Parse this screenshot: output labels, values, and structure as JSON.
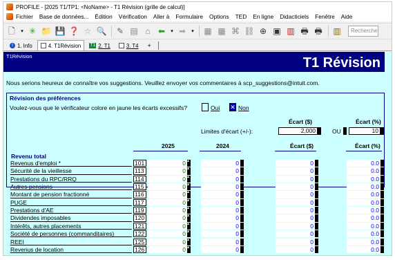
{
  "window": {
    "title": "PROFILE - [2025 T1/TP1: <NoName> - T1 Révision (grille de calcul)]"
  },
  "menu": [
    "Fichier",
    "Base de données...",
    "Édition",
    "Vérification",
    "Aller à",
    "Formulaire",
    "Options",
    "TED",
    "En ligne",
    "Didacticiels",
    "Fenêtre",
    "Aide"
  ],
  "toolbar": {
    "search_placeholder": "Recherche"
  },
  "tabs": [
    {
      "label": "1. Info",
      "icon": "info-icon"
    },
    {
      "label": "4. T1Révision",
      "icon": "document-icon",
      "active": true
    },
    {
      "label": "2. T1",
      "icon": "t1-form-icon"
    },
    {
      "label": "3. T4",
      "icon": "t4-form-icon"
    },
    {
      "label": "+"
    }
  ],
  "form": {
    "small_title": "T1Révision",
    "big_title": "T1 Révision",
    "suggestion": "Nous serions heureux de connaître vos suggestions.  Veuillez envoyer vos commentaires à scp_suggestions@intuit.com.",
    "pref_title": "Révision des préférences",
    "pref_question": "Voulez-vous que le vérificateur colore en jaune les écarts excessifs?",
    "oui": "Oui",
    "non": "Non",
    "ecart_dollar": "Écart ($)",
    "ecart_pct": "Écart (%)",
    "limites_label": "Limites d'écart (+/-):",
    "limit_dollar": "2,000",
    "limit_pct": "10",
    "ou": "OU",
    "col_2025": "2025",
    "col_2024": "2024",
    "section": "Revenu total",
    "rows": [
      {
        "label": "Revenus d'emploi *",
        "code": "101",
        "v2025": "0",
        "v2024": "0",
        "ecart": "0",
        "pct": "0.0"
      },
      {
        "label": "Sécurité de la vieillesse",
        "code": "113",
        "v2025": "0",
        "v2024": "0",
        "ecart": "0",
        "pct": "0.0"
      },
      {
        "label": "Prestations du RPC/RRQ",
        "code": "114",
        "v2025": "0",
        "v2024": "0",
        "ecart": "0",
        "pct": "0.0"
      },
      {
        "label": "Autres pensions",
        "code": "115",
        "v2025": "0",
        "v2024": "0",
        "ecart": "0",
        "pct": "0.0"
      },
      {
        "label": "Montant de pension fractionné",
        "code": "116",
        "v2025": "0",
        "v2024": "0",
        "ecart": "0",
        "pct": "0.0"
      },
      {
        "label": "PUGE",
        "code": "117",
        "v2025": "0",
        "v2024": "0",
        "ecart": "0",
        "pct": "0.0"
      },
      {
        "label": "Prestations d'AE",
        "code": "119",
        "v2025": "0",
        "v2024": "0",
        "ecart": "0",
        "pct": "0.0"
      },
      {
        "label": "Dividendes imposables",
        "code": "120",
        "v2025": "0",
        "v2024": "0",
        "ecart": "0",
        "pct": "0.0"
      },
      {
        "label": "Intérêts, autres placements",
        "code": "121",
        "v2025": "0",
        "v2024": "0",
        "ecart": "0",
        "pct": "0.0"
      },
      {
        "label": "Société de personnes (commanditaires)",
        "code": "122",
        "v2025": "0",
        "v2024": "0",
        "ecart": "0",
        "pct": "0.0"
      },
      {
        "label": "REEI",
        "code": "125",
        "v2025": "0",
        "v2024": "0",
        "ecart": "0",
        "pct": "0.0"
      },
      {
        "label": "Revenus de location",
        "code": "126",
        "v2025": "0",
        "v2024": "0",
        "ecart": "0",
        "pct": "0.0"
      }
    ]
  },
  "colors": {
    "header_bg": "#000080",
    "form_bg": "#ccffff",
    "green_value": "#008000",
    "blue_value": "#0000ff"
  }
}
